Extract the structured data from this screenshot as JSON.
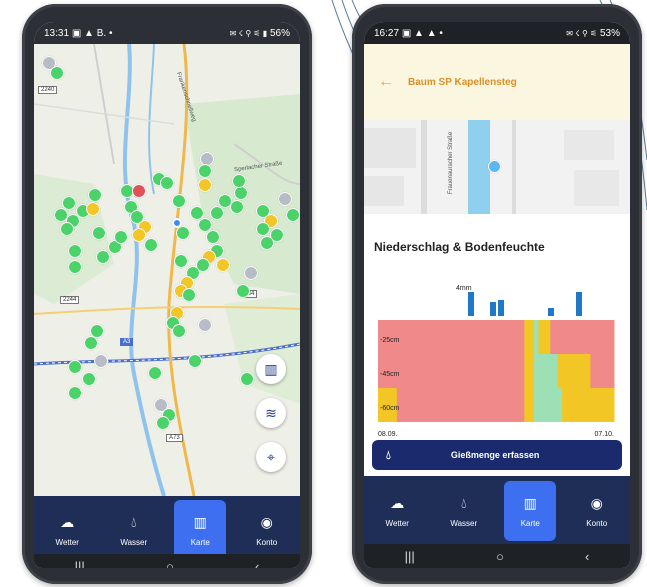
{
  "left_phone": {
    "status": {
      "time": "13:31",
      "left_icons": "▣ ▲ B. •",
      "right_icons": "✉ ☇ ⚲ ⚟ ▮",
      "battery": "56%"
    },
    "map": {
      "road_labels": [
        "2240",
        "2244",
        "B4",
        "A3",
        "A73"
      ],
      "street_labels": [
        "Frankenschnellweg",
        "Sperlacher Straße"
      ]
    },
    "map_buttons": [
      {
        "name": "map-layers-button",
        "icon": "map-icon"
      },
      {
        "name": "stack-button",
        "icon": "layers-icon"
      },
      {
        "name": "locate-button",
        "icon": "crosshair-icon"
      }
    ]
  },
  "right_phone": {
    "status": {
      "time": "16:27",
      "left_icons": "▣ ▲ ▲ •",
      "right_icons": "✉ ☇ ⚲ ⚟",
      "battery": "53%"
    },
    "header": {
      "title": "Baum SP Kapellensteg"
    },
    "map": {
      "street_label": "Frauenauracher Straße"
    },
    "section_title": "Niederschlag & Bodenfeuchte",
    "chart_data": {
      "type": "heatmap",
      "title": "Niederschlag & Bodenfeuchte",
      "annotation": "4mm",
      "x_start": "08.09.",
      "x_end": "07.10.",
      "rows": [
        "-25cm",
        "-45cm",
        "-60cm"
      ],
      "precip_bar_color": "#1f78c8",
      "moisture_colors": {
        "dry": "#f08a8a",
        "medium": "#f2c624",
        "wet": "#9ee0b5"
      }
    },
    "cta": {
      "label": "Gießmenge erfassen"
    }
  },
  "nav": {
    "items": [
      {
        "label": "Wetter",
        "icon": "cloud-icon"
      },
      {
        "label": "Wasser",
        "icon": "drop-icon"
      },
      {
        "label": "Karte",
        "icon": "map-icon",
        "active": true
      },
      {
        "label": "Konto",
        "icon": "account-icon"
      }
    ]
  },
  "sysnav": {
    "recent": "|||",
    "home": "○",
    "back": "‹"
  }
}
